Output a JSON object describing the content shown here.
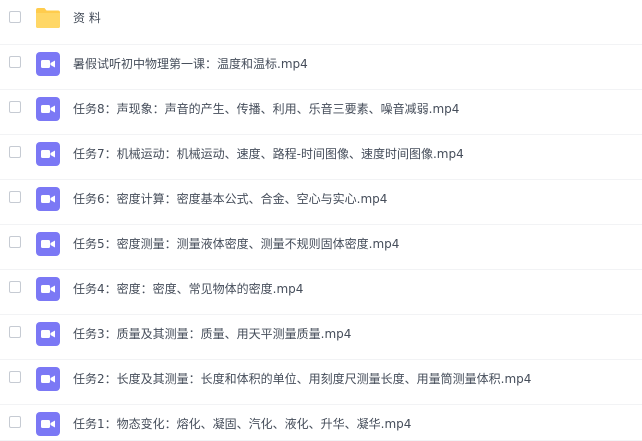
{
  "file_list": {
    "folder": {
      "name": "资 料",
      "icon": "folder-icon",
      "color": "#ffcc4d"
    },
    "videos": [
      {
        "name": "暑假试听初中物理第一课：温度和温标.mp4",
        "icon": "video-file-icon"
      },
      {
        "name": "任务8：声现象：声音的产生、传播、利用、乐音三要素、噪音减弱.mp4",
        "icon": "video-file-icon"
      },
      {
        "name": "任务7：机械运动：机械运动、速度、路程-时间图像、速度时间图像.mp4",
        "icon": "video-file-icon"
      },
      {
        "name": "任务6：密度计算：密度基本公式、合金、空心与实心.mp4",
        "icon": "video-file-icon"
      },
      {
        "name": "任务5：密度测量：测量液体密度、测量不规则固体密度.mp4",
        "icon": "video-file-icon"
      },
      {
        "name": "任务4：密度：密度、常见物体的密度.mp4",
        "icon": "video-file-icon"
      },
      {
        "name": "任务3：质量及其测量：质量、用天平测量质量.mp4",
        "icon": "video-file-icon"
      },
      {
        "name": "任务2：长度及其测量：长度和体积的单位、用刻度尺测量长度、用量筒测量体积.mp4",
        "icon": "video-file-icon"
      },
      {
        "name": "任务1：物态变化：熔化、凝固、汽化、液化、升华、凝华.mp4",
        "icon": "video-file-icon"
      }
    ],
    "video_icon_color": "#7b78f5"
  }
}
